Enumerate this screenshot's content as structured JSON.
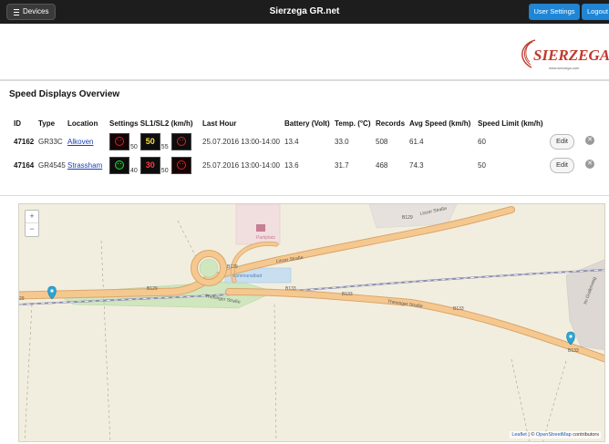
{
  "topbar": {
    "devices_label": "Devices",
    "title": "Sierzega GR.net",
    "user_settings_label": "User Settings",
    "logout_label": "Logout"
  },
  "logo": {
    "brand": "SIERZEGA",
    "url": "www.sierzega.com"
  },
  "overview": {
    "title": "Speed Displays Overview",
    "columns": [
      "ID",
      "Type",
      "Location",
      "Settings SL1/SL2 (km/h)",
      "Last Hour",
      "Battery (Volt)",
      "Temp. (°C)",
      "Records",
      "Avg Speed (km/h)",
      "Speed Limit (km/h)"
    ],
    "rows": [
      {
        "id": "47162",
        "type": "GR33C",
        "location": "Alkoven",
        "sl1": "50",
        "speed_sign": "50",
        "sl2": "55",
        "last_hour": "25.07.2016 13:00-14:00",
        "battery": "13.4",
        "temp": "33.0",
        "records": "508",
        "avg_speed": "61.4",
        "speed_limit": "60",
        "edit_label": "Edit"
      },
      {
        "id": "47164",
        "type": "GR4545",
        "location": "Strassham",
        "sl1": "40",
        "speed_sign": "30",
        "sl2": "50",
        "last_hour": "25.07.2016 13:00-14:00",
        "battery": "13.6",
        "temp": "31.7",
        "records": "468",
        "avg_speed": "74.3",
        "speed_limit": "50",
        "edit_label": "Edit"
      }
    ]
  },
  "map": {
    "zoom_in": "+",
    "zoom_out": "−",
    "labels": {
      "b129_top": "B129",
      "linzer_strasse_top": "Linzer Straße",
      "b129_center": "B129",
      "linzer_strasse_center": "Linzer Straße",
      "b129_left": "B129",
      "num_29": "29",
      "theninger_strasse_left": "Theninger Straße",
      "b133_a": "B133",
      "b133_b": "B133",
      "theninger_strasse_right": "Theninger Straße",
      "b133_c": "B133",
      "b133_d": "B133",
      "pool": "Kommunalbad",
      "parking": "Parkplatz",
      "side_road": "Im Grafenweg"
    },
    "attribution_leaflet": "Leaflet",
    "attribution_sep": " | © ",
    "attribution_osm": "OpenStreetMap",
    "attribution_tail": " contributors"
  },
  "colors": {
    "topbar": "#1d1d1d",
    "accent": "#1f86d6",
    "road": "#f5c890",
    "road_edge": "#d9a66a",
    "rail": "#8f8fb0",
    "marker": "#2aa6d6"
  },
  "icons": [
    "hamburger-icon",
    "frown-face-icon",
    "smile-face-icon",
    "remove-icon",
    "map-marker-icon"
  ]
}
